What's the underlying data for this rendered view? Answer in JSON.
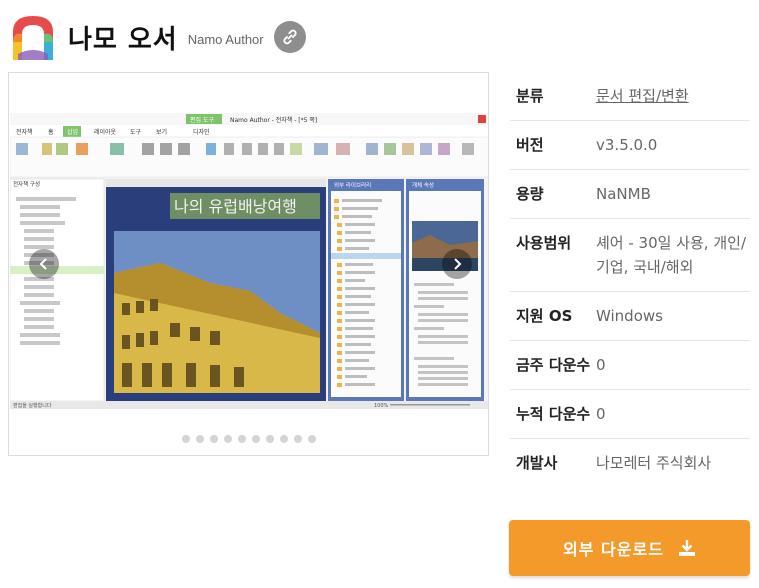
{
  "app": {
    "name": "나모 오서",
    "subtitle": "Namo Author"
  },
  "colors": {
    "accent": "#f39a2b",
    "link_btn": "#8e8e8e"
  },
  "carousel": {
    "dot_count": 10,
    "screenshot": {
      "toolbar_tab": "편집 도구",
      "window_title": "Namo Author - 전자책 - [*5 쪽]",
      "ribbon_tabs": [
        "전자책",
        "홈",
        "삽입",
        "레이아웃",
        "도구",
        "보기",
        "디자인"
      ],
      "panel_left_title": "전자책 구성",
      "slide_title": "나의 유럽배낭여행",
      "panel_lib_title": "외부 라이브러리",
      "panel_gallery_title": "개체 속성",
      "status_text": "편집을 실행합니다",
      "zoom": "100%"
    }
  },
  "info": {
    "rows": [
      {
        "label": "분류",
        "value": "문서 편집/변환"
      },
      {
        "label": "버전",
        "value": "v3.5.0.0"
      },
      {
        "label": "용량",
        "value": "NaNMB"
      },
      {
        "label": "사용범위",
        "value": "셰어 - 30일 사용, 개인/기업, 국내/해외"
      },
      {
        "label": "지원 OS",
        "value": "Windows"
      },
      {
        "label": "금주 다운수",
        "value": "0"
      },
      {
        "label": "누적 다운수",
        "value": "0"
      },
      {
        "label": "개발사",
        "value": "나모레터 주식회사"
      }
    ]
  },
  "download": {
    "label": "외부 다운로드"
  },
  "icons": {
    "logo": "namo-logo-icon",
    "link": "link-icon",
    "prev": "chevron-left-icon",
    "next": "chevron-right-icon",
    "download": "download-icon"
  }
}
